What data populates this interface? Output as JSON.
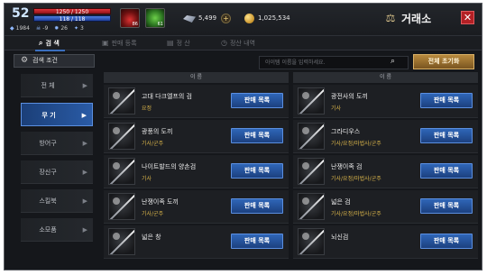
{
  "player": {
    "level": "52",
    "hp": "1250 / 1250",
    "mp": "118 / 118",
    "stats": [
      {
        "icon": "crystal-icon",
        "value": "1984"
      },
      {
        "icon": "skull-icon",
        "value": "-9"
      },
      {
        "icon": "fire-icon",
        "value": "26"
      },
      {
        "icon": "sword-icon",
        "value": "3"
      }
    ],
    "buffs": [
      {
        "icon": "red-potion-icon",
        "count": "86"
      },
      {
        "icon": "green-leaf-icon",
        "count": "61"
      }
    ]
  },
  "currency": {
    "gems": "5,499",
    "gold": "1,025,534"
  },
  "window": {
    "title": "거래소",
    "icon": "scale-icon"
  },
  "tabs": [
    {
      "label": "검 색",
      "icon": "search-icon",
      "active": true
    },
    {
      "label": "판매 등록",
      "icon": "register-icon",
      "active": false
    },
    {
      "label": "정 산",
      "icon": "settle-icon",
      "active": false
    },
    {
      "label": "정산 내역",
      "icon": "history-icon",
      "active": false
    }
  ],
  "sidebar": {
    "search_conditions": "검색 조건",
    "categories": [
      {
        "label": "전 체",
        "active": false
      },
      {
        "label": "무 기",
        "active": true
      },
      {
        "label": "방어구",
        "active": false
      },
      {
        "label": "장신구",
        "active": false
      },
      {
        "label": "스킬북",
        "active": false
      },
      {
        "label": "소모품",
        "active": false
      }
    ]
  },
  "search": {
    "placeholder": "아이템 이름을 입력하세요.",
    "reset_label": "전체 초기화"
  },
  "table": {
    "header_left": "이 름",
    "header_right": "이 름",
    "sell_label": "판매 목록",
    "items": [
      {
        "name": "고대 다크엘프의 검",
        "class": "요정"
      },
      {
        "name": "광전사의 도끼",
        "class": "기사"
      },
      {
        "name": "광풍의 도끼",
        "class": "기사/군주"
      },
      {
        "name": "그라디우스",
        "class": "기사/요정/마법사/군주"
      },
      {
        "name": "나이트발드의 양손검",
        "class": "기사"
      },
      {
        "name": "난쟁이족 검",
        "class": "기사/요정/마법사/군주"
      },
      {
        "name": "난쟁이족 도끼",
        "class": "기사/군주"
      },
      {
        "name": "넓은 검",
        "class": "기사/요정/마법사/군주"
      },
      {
        "name": "넓은 창",
        "class": ""
      },
      {
        "name": "뇌신검",
        "class": ""
      }
    ]
  },
  "colors": {
    "accent_blue": "#2f66b8",
    "gold_button": "#b88a3e",
    "close_red": "#b32025",
    "class_text": "#d9b44a"
  }
}
